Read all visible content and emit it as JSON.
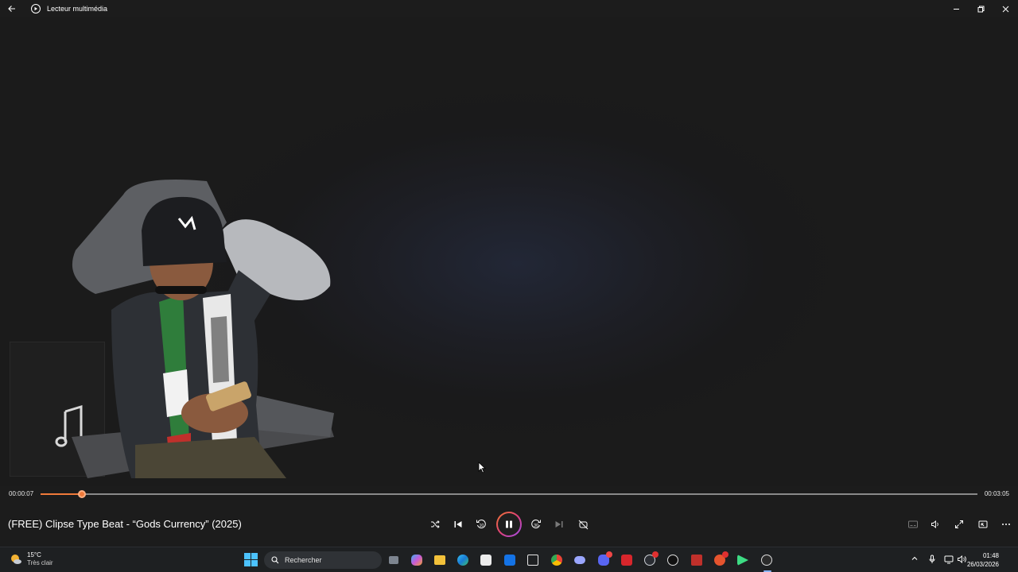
{
  "window": {
    "title": "Lecteur multimédia",
    "icons": {
      "back": "back-arrow-icon",
      "app": "play-circle-icon",
      "minimize": "minimize-icon",
      "restore": "restore-icon",
      "close": "close-icon"
    }
  },
  "player": {
    "current_time": "00:00:07",
    "total_time": "00:03:05",
    "progress_fraction": 0.044,
    "accent_color": "#f07a3a",
    "song_title": "(FREE) Clipse Type Beat - “Gods Currency” (2025)",
    "state": "playing",
    "controls": [
      "shuffle-icon",
      "previous-icon",
      "rewind-10-icon",
      "pause-icon",
      "forward-30-icon",
      "next-icon",
      "repeat-off-icon"
    ],
    "right_controls": [
      "subtitles-icon",
      "volume-icon",
      "fullscreen-icon",
      "mini-player-icon",
      "more-icon"
    ]
  },
  "taskbar": {
    "weather": {
      "temp": "15°C",
      "desc": "Très clair",
      "icon": "moon-cloud-icon"
    },
    "search_placeholder": "Rechercher",
    "apps": [
      "windows-start-icon",
      "task-view-icon",
      "copilot-icon",
      "file-explorer-icon",
      "edge-icon",
      "store-icon",
      "outlook-icon",
      "snipping-icon",
      "chrome-icon",
      "controller-icon",
      "discord-icon",
      "acrobat-icon",
      "steam-icon",
      "obs-icon",
      "video-app-icon",
      "game-app-icon",
      "android-studio-icon",
      "media-player-icon"
    ],
    "tray": [
      "chevron-up-icon",
      "microphone-icon",
      "display-icon",
      "speaker-icon"
    ],
    "time": "01:48",
    "date": "26/03/2026"
  }
}
